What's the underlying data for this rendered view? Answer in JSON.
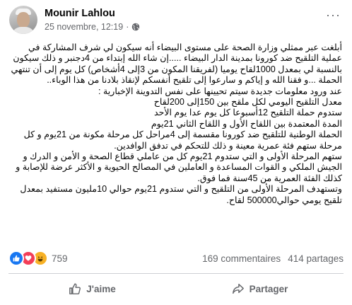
{
  "post": {
    "author": "Mounir Lahlou",
    "timestamp": "25 novembre, 12:19",
    "separator": "·",
    "audience_icon": "globe-icon",
    "more_icon": "more-options-icon",
    "more_label": "···",
    "body_lines": [
      "أبلغت عبر ممثلي وزارة الصحة على مستوى البيضاء أنه سيكون لي شرف المشاركة في عملية التلقيح ضد كورونا بمدينة الدار البيضاء .....إن شاء الله إبتداء من 4دجنبر و ذلك سيكون بالنسبة لي بمعدل 1000لقاح يوميا (لفريقنا المكون من 3إلى 4أشخاص) كل يوم إلى أن تنتهي الحملة ...و فقنا الله و إياكم و سارعوا إلى تلقيح أنفسكم لإنقاذ بلادنا من هذا الوباء..",
      "عند ورود معلومات جديدة سيتم تحيينها على نفس التدوينة الإخبارية :",
      "معدل التلقيح اليومي لكل ملقح بين 150إلى 200لقاح",
      "ستدوم حملة التلقيح 12أسبوعا كل يوم عدا يوم الأحد",
      "المدة المعتمدة بين اللقاح الأول و اللقاح الثاني 21يوم",
      "الحملة الوطنية للتلقيح ضد كورونا مقسمة إلى 4مراحل كل مرحلة مكونة من 21يوم و كل مرحلة ستهم فئة عمرية معينة و ذلك للتحكم في تدفق الوافدين.",
      "ستهم المرحلة الأولى و التي ستدوم 21يوم كل من عاملي قطاع الصحة و الأمن و الدرك و الجيش الملكي و القوات المساعدة و العاملين في المصالح الحيوية و الأكثر عرضة للإصابة و كذلك الفئة العمرية من 45سنة فما فوق.",
      "وتستهدف المرحلة الأولى من التلقيح و التي ستدوم 21يوم حوالي 10مليون مستفيد بمعدل تلقيح يومي حوالي500000 لقاح."
    ]
  },
  "reactions": {
    "icons": [
      "like-icon",
      "love-icon",
      "haha-icon"
    ],
    "count": "759",
    "comments": "169 commentaires",
    "shares": "414 partages"
  },
  "actions": {
    "like_label": "J'aime",
    "share_label": "Partager"
  },
  "colors": {
    "like_blue": "#1877f2",
    "love_red": "#f33e58",
    "haha_yellow": "#f7b125",
    "secondary_text": "#65676b"
  }
}
